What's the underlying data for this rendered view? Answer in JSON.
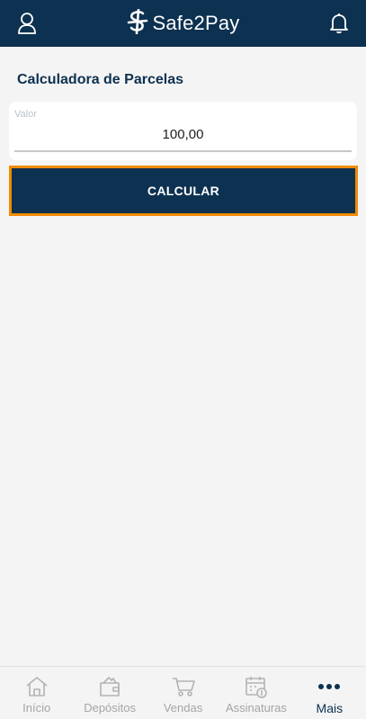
{
  "header": {
    "brand": "Safe2Pay",
    "left_icon": "user-icon",
    "right_icon": "bell-icon",
    "background": "#0d3150"
  },
  "page": {
    "title": "Calculadora de Parcelas"
  },
  "form": {
    "field_label": "Valor",
    "field_value": "100,00",
    "submit_label": "CALCULAR",
    "submit_highlight_color": "#f08a00"
  },
  "bottom_nav": {
    "items": [
      {
        "label": "Início",
        "icon": "home-icon",
        "active": false
      },
      {
        "label": "Depósitos",
        "icon": "wallet-icon",
        "active": false
      },
      {
        "label": "Vendas",
        "icon": "cart-icon",
        "active": false
      },
      {
        "label": "Assinaturas",
        "icon": "calendar-icon",
        "active": false
      },
      {
        "label": "Mais",
        "icon": "more-icon",
        "active": true
      }
    ]
  }
}
